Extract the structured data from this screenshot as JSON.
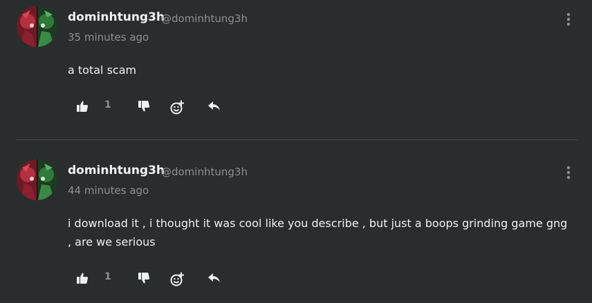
{
  "comments": [
    {
      "username": "dominhtung3h",
      "handle": "@dominhtung3h",
      "timestamp": "35 minutes ago",
      "text": "a total scam",
      "like_count": "1"
    },
    {
      "username": "dominhtung3h",
      "handle": "@dominhtung3h",
      "timestamp": "44 minutes ago",
      "text": "i download it , i thought it was cool like you describe , but just a boops grinding game gng , are we serious",
      "like_count": "1"
    }
  ],
  "icons": {
    "like": "thumbs-up-icon",
    "dislike": "thumbs-down-icon",
    "react": "add-emoji-icon",
    "reply": "reply-icon",
    "more": "more-vertical-icon"
  },
  "colors": {
    "background": "#2a2d2e",
    "text": "#f0f0f0",
    "muted": "#8d9192",
    "divider": "#474b4c"
  }
}
